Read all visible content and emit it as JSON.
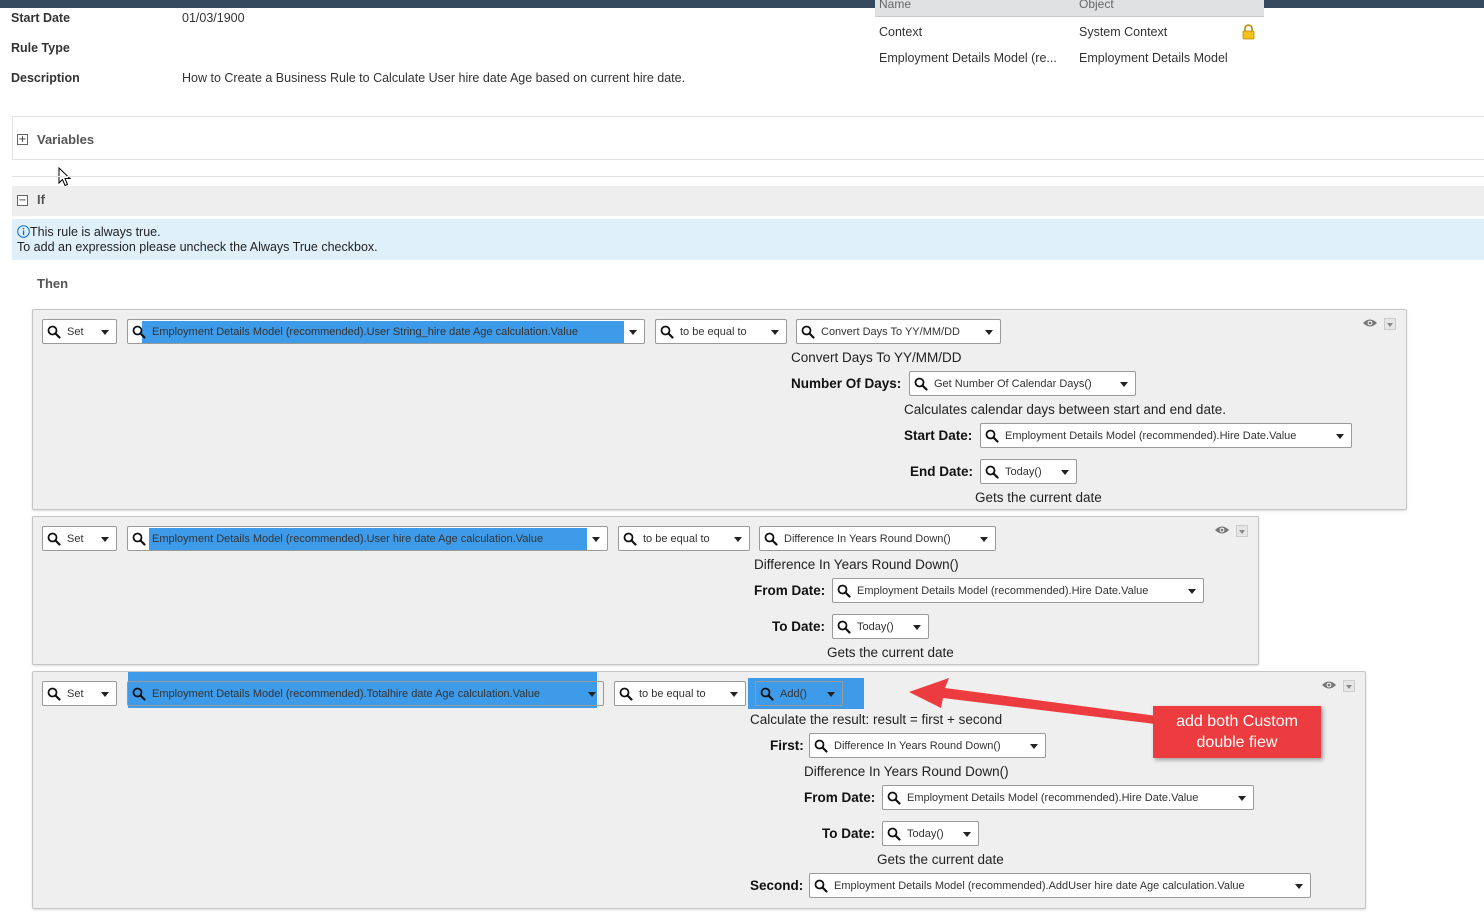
{
  "meta": {
    "start_date_label": "Start Date",
    "start_date_value": "01/03/1900",
    "rule_type_label": "Rule Type",
    "description_label": "Description",
    "description_value": "How to Create a Business Rule to Calculate User hire date Age based on current hire date."
  },
  "context_table": {
    "col_name": "Name",
    "col_object": "Object",
    "rows": [
      {
        "name": "Context",
        "object": "System Context"
      },
      {
        "name": "Employment Details Model (re...",
        "object": "Employment Details Model"
      }
    ]
  },
  "sections": {
    "variables": "Variables",
    "if": "If",
    "then": "Then"
  },
  "info": {
    "line1": "This rule is always true.",
    "line2": "To add an expression please uncheck the Always True checkbox."
  },
  "rules": [
    {
      "action": "Set",
      "target": "Employment Details Model (recommended).User String_hire date Age calculation.Value",
      "operator": "to be equal to",
      "func": "Convert Days To YY/MM/DD",
      "func_desc": "Convert Days To YY/MM/DD",
      "param1_label": "Number Of Days:",
      "param1_value": "Get Number Of Calendar Days()",
      "param1_desc": "Calculates calendar days between start and end date.",
      "sub1_label": "Start Date:",
      "sub1_value": "Employment Details Model (recommended).Hire Date.Value",
      "sub2_label": "End Date:",
      "sub2_value": "Today()",
      "sub2_desc": "Gets the current date"
    },
    {
      "action": "Set",
      "target": "Employment Details Model (recommended).User hire date Age calculation.Value",
      "operator": "to be equal to",
      "func": "Difference In Years Round Down()",
      "func_desc": "Difference In Years Round Down()",
      "param1_label": "From Date:",
      "param1_value": "Employment Details Model (recommended).Hire Date.Value",
      "param2_label": "To Date:",
      "param2_value": "Today()",
      "param2_desc": "Gets the current date"
    },
    {
      "action": "Set",
      "target": "Employment Details Model (recommended).Totalhire date Age calculation.Value",
      "operator": "to be equal to",
      "func": "Add()",
      "func_desc": "Calculate the result: result = first + second",
      "first_label": "First:",
      "first_value": "Difference In Years Round Down()",
      "first_desc": "Difference In Years Round Down()",
      "from_label": "From Date:",
      "from_value": "Employment Details Model (recommended).Hire Date.Value",
      "to_label": "To Date:",
      "to_value": "Today()",
      "to_desc": "Gets the current date",
      "second_label": "Second:",
      "second_value": "Employment Details Model (recommended).AddUser hire date Age calculation.Value"
    }
  ],
  "annotation": {
    "text_line1": "add both Custom",
    "text_line2": "double fiew",
    "color": "#ec3c3f"
  },
  "colors": {
    "highlight": "#3d9be9",
    "topbar": "#354a5f",
    "info_bg": "#dff0fb"
  }
}
